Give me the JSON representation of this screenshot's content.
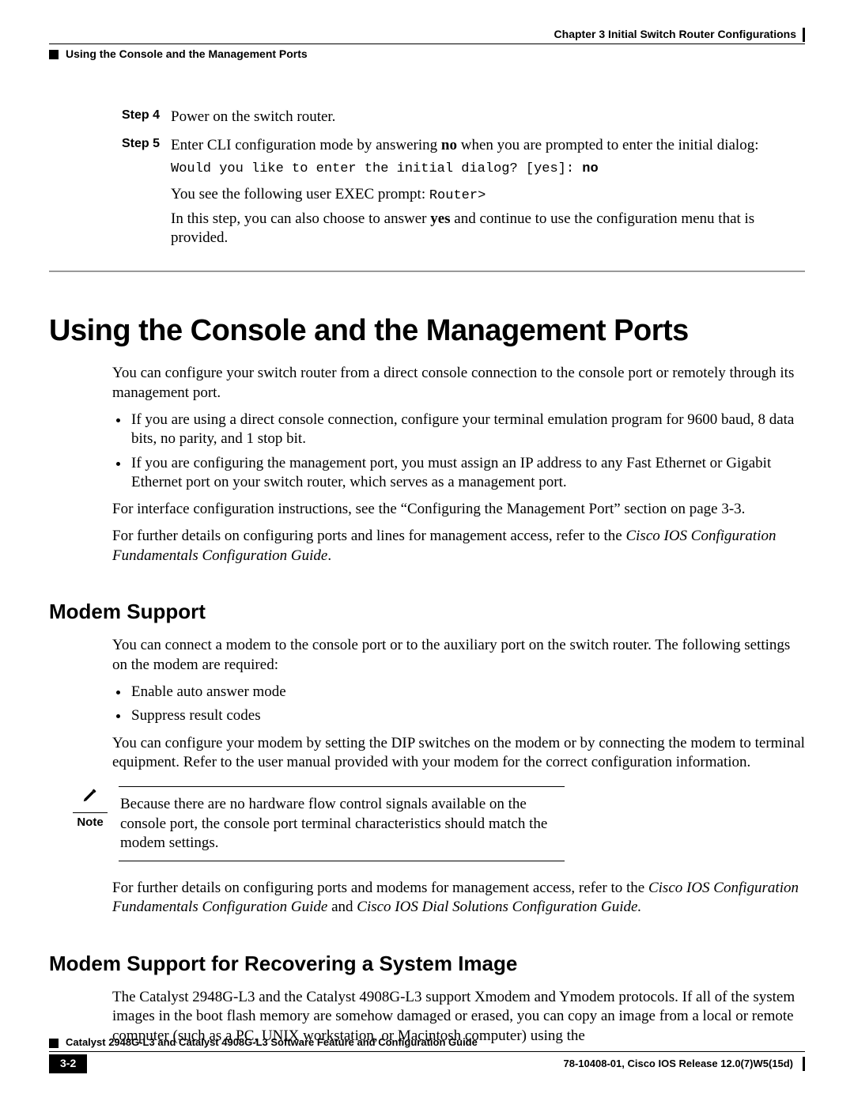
{
  "header": {
    "chapter": "Chapter 3      Initial Switch Router Configurations",
    "section": "Using the Console and the Management Ports"
  },
  "steps": {
    "s4": {
      "label": "Step 4",
      "text": "Power on the switch router."
    },
    "s5": {
      "label": "Step 5",
      "line1_a": "Enter CLI configuration mode by answering ",
      "line1_bold": "no",
      "line1_b": " when you are prompted to enter the initial dialog:",
      "cli_a": "Would you like to enter the initial dialog? [yes]: ",
      "cli_bold": "no",
      "line2_a": "You see the following user EXEC prompt: ",
      "line2_mono": "Router>",
      "line3_a": "In this step, you can also choose to answer ",
      "line3_bold": "yes",
      "line3_b": " and continue to use the configuration menu that is provided."
    }
  },
  "h1": "Using the Console and the Management Ports",
  "p_intro": "You can configure your switch router from a direct console connection to the console port or remotely through its management port.",
  "bullets1": {
    "b1": "If you are using a direct console connection, configure your terminal emulation program for 9600 baud, 8 data bits, no parity, and 1 stop bit.",
    "b2": "If you are configuring the management port, you must assign an IP address to any Fast Ethernet or Gigabit Ethernet port on your switch router, which serves as a management port."
  },
  "p_xref": "For interface configuration instructions, see the “Configuring the Management Port” section on page 3-3.",
  "p_further_a": "For further details on configuring ports and lines for management access, refer to the ",
  "p_further_it": "Cisco IOS Configuration Fundamentals Configuration Guide",
  "p_further_b": ".",
  "h2_modem": "Modem Support",
  "p_modem1": "You can connect a modem to the console port or to the auxiliary port on the switch router. The following settings on the modem are required:",
  "bullets2": {
    "b1": "Enable auto answer mode",
    "b2": "Suppress result codes"
  },
  "p_modem2": "You can configure your modem by setting the DIP switches on the modem or by connecting the modem to terminal equipment. Refer to the user manual provided with your modem for the correct configuration information.",
  "note": {
    "label": "Note",
    "text": "Because there are no hardware flow control signals available on the console port, the console port terminal characteristics should match the modem settings."
  },
  "p_modem3_a": "For further details on configuring ports and modems for management access, refer to the ",
  "p_modem3_it1": "Cisco IOS Configuration Fundamentals Configuration Guide",
  "p_modem3_mid": " and ",
  "p_modem3_it2": "Cisco IOS Dial Solutions Configuration Guide.",
  "h2_recover": "Modem Support for Recovering a System Image",
  "p_recover": "The Catalyst 2948G-L3 and the Catalyst 4908G-L3 support Xmodem and Ymodem protocols. If all of the system images in the boot flash memory are somehow damaged or erased, you can copy an image from a local or remote computer (such as a PC, UNIX workstation, or Macintosh computer) using the",
  "footer": {
    "book": "Catalyst 2948G-L3 and Catalyst 4908G-L3 Software Feature and Configuration Guide",
    "page": "3-2",
    "release": "78-10408-01, Cisco IOS Release 12.0(7)W5(15d)"
  }
}
